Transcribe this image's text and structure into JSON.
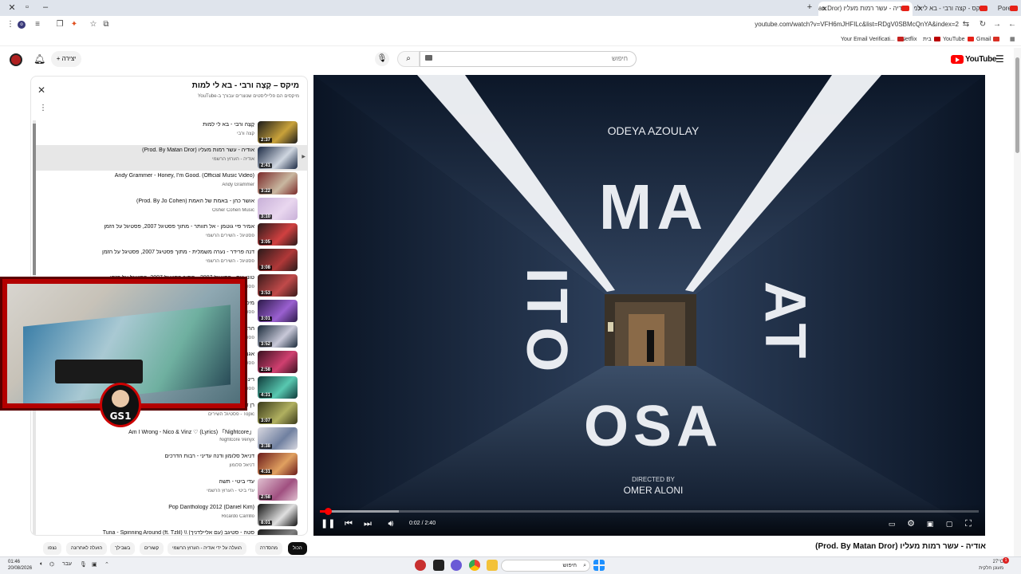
{
  "browser": {
    "tabs": [
      {
        "title": "אודיה - עשר רמות מעליו (Prod. By Matan Dror)",
        "active": true
      },
      {
        "title": "מיקס - קצה ורבי - בא לי למות",
        "active": false
      },
      {
        "title": "Poretz",
        "active": false
      }
    ],
    "new_tab": "+",
    "url": "youtube.com/watch?v=VFH6mJHFILc&list=RDgV0SBMcQnYA&index=2",
    "bookmarks": [
      {
        "label": "Gmail",
        "icon": "gmail-icon"
      },
      {
        "label": "YouTube",
        "icon": "youtube-icon"
      },
      {
        "label": "בית",
        "icon": "netflix-icon"
      },
      {
        "label": "Netflix",
        "icon": "netflix-icon"
      },
      {
        "label": "Your Email Verificati...",
        "icon": "mail-icon"
      }
    ]
  },
  "masthead": {
    "create_label": "יצירה",
    "search_placeholder": "חיפוש",
    "logo_text": "YouTube"
  },
  "playlist": {
    "title": "מיקס – קֶצֶה ורבי - בא לי למות",
    "subtitle": "מיקסים הם פלייליסטים שנוצרים עבורך ב-YouTube",
    "items": [
      {
        "title": "קֶצֶה ורבי - בא לי למות",
        "channel": "קצה ורבי",
        "duration": "2:37",
        "active": false,
        "thumb": [
          "#1b1b1b",
          "#c9a23a"
        ]
      },
      {
        "title": "אודיה - עשר רמות מעליו (Prod. By Matan Dror)",
        "channel": "אודיה - הערוץ הרשמי",
        "duration": "2:41",
        "active": true,
        "thumb": [
          "#1c2a44",
          "#cfd6e0"
        ]
      },
      {
        "title": "Andy Grammer - Honey, I'm Good. (Official Music Video)",
        "channel": "Andy Grammer",
        "duration": "3:22",
        "active": false,
        "thumb": [
          "#7a2a2a",
          "#c9b7a0"
        ]
      },
      {
        "title": "אושר כהן - באמת של האמת (Prod. By Jo Cohen)",
        "channel": "Osher Cohen Music",
        "duration": "3:10",
        "active": false,
        "thumb": [
          "#c8b0d8",
          "#e9d7ef"
        ]
      },
      {
        "title": "אמיר פיי גוטמן - אל תוותר - מתוך פסטיגל 2007, פסטיגל על הזמן",
        "channel": "פסטיגל - השירים הרשמי",
        "duration": "3:05",
        "active": false,
        "thumb": [
          "#2a1a1a",
          "#d04040"
        ]
      },
      {
        "title": "דנה פרידר - נערה משמלית - מתוך פסטיגל 2007, פסטיגל על הזמן",
        "channel": "פסטיגל - השירים הרשמי",
        "duration": "3:08",
        "active": false,
        "thumb": [
          "#2a1a1a",
          "#b03838"
        ]
      },
      {
        "title": "טוני וייס - פסטיגל 2007 - מתוך פסטיגל 2007, פסטיגל על הזמן",
        "channel": "פסטיגל - השירים הרשמי",
        "duration": "3:53",
        "active": false,
        "thumb": [
          "#3a1a1a",
          "#c04a4a"
        ]
      },
      {
        "title": "מיכל הקטנה - פסטיגל 2007",
        "channel": "פסטיגל - השירים הרשמי",
        "duration": "3:01",
        "active": false,
        "thumb": [
          "#2c1a4a",
          "#9a60d0"
        ]
      },
      {
        "title": "הראל סקעת - פסטיגל 2007",
        "channel": "פסטיגל - השירים הרשמי",
        "duration": "3:52",
        "active": false,
        "thumb": [
          "#1a2a3a",
          "#c8c8d8"
        ]
      },
      {
        "title": "אגם בוחבוט - פסטיגל 2007",
        "channel": "פסטיגל - השירים הרשמי",
        "duration": "2:58",
        "active": false,
        "thumb": [
          "#3a1020",
          "#d04070"
        ]
      },
      {
        "title": "רינת בר - פסטיגל 2007",
        "channel": "פסטיגל - השירים הרשמי",
        "duration": "4:31",
        "active": false,
        "thumb": [
          "#0f3a3a",
          "#58c8b0"
        ]
      },
      {
        "title": "רן דנקר - פסטיגל 2007",
        "channel": "Topic - פסטיגל השירים",
        "duration": "3:07",
        "active": false,
        "thumb": [
          "#3a3a1a",
          "#b0b060"
        ]
      },
      {
        "title": "Am I Wrong - Nico & Vinz ♡ (Lyrics) 「Nightcore」",
        "channel": "Nightcore Venyx",
        "duration": "3:38",
        "active": false,
        "thumb": [
          "#d8d8e0",
          "#7080a0"
        ]
      },
      {
        "title": "דניאל סלומון ודנה עדיני - רבות הדרכים",
        "channel": "דניאל סלומון",
        "duration": "4:31",
        "active": false,
        "thumb": [
          "#6a1a1a",
          "#e0a060"
        ]
      },
      {
        "title": "עדי ביטי - תשה",
        "channel": "עדי ביטי - הערוץ הרשמי",
        "duration": "2:58",
        "active": false,
        "thumb": [
          "#e0c0d0",
          "#a05080"
        ]
      },
      {
        "title": "Pop Danthology 2012 (Daniel Kim)",
        "channel": "Ricardo Carrillo",
        "duration": "8:01",
        "active": false,
        "thumb": [
          "#111111",
          "#e0e0e0"
        ]
      },
      {
        "title": "סטה - סטיגב (עם אליילדניך) \\\\ Tuna - Spinning Around (ft. Tzlil)",
        "channel": "",
        "duration": "",
        "active": false,
        "thumb": [
          "#1a1a1a",
          "#808080"
        ]
      }
    ]
  },
  "webcam": {
    "badge_text": "GS1"
  },
  "video": {
    "artist_text": "ODEYA AZOULAY",
    "big_top": "MA",
    "big_left": "ITO",
    "big_right": "AT",
    "big_bottom": "OSA",
    "directed_by": "DIRECTED BY",
    "director": "OMER ALONI",
    "time_current": "0:02",
    "time_total": "2:40",
    "progress": 0.0125,
    "buffered": 0.12,
    "title": "אודיה - עשר רמות מעליו (Prod. By Matan Dror)"
  },
  "chips": [
    "הכול",
    "מהסדרה",
    "הועלה על ידי אודיה - הערוץ הרשמי",
    "קשורים",
    "בשבילך",
    "הועלה לאחרונה",
    "נצפו"
  ],
  "taskbar": {
    "time": "01:46",
    "date": "20/08/2026",
    "lang": "עבר",
    "search_label": "חיפוש",
    "weather_temp": "27°C",
    "weather_desc": "מעונן חלקית",
    "notif_count": "1"
  },
  "colors": {
    "accent_red": "#ff0000",
    "video_bg": "#0b1627"
  }
}
